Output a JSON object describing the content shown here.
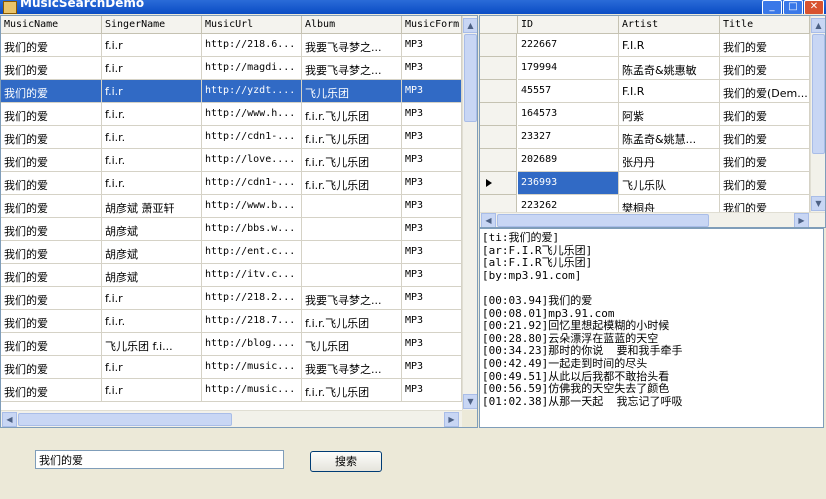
{
  "window": {
    "title": "MusicSearchDemo",
    "minimize": "_",
    "maximize": "□",
    "close": "✕"
  },
  "left_grid": {
    "columns": [
      "MusicName",
      "SingerName",
      "MusicUrl",
      "Album",
      "MusicForm"
    ],
    "selected_index": 2,
    "rows": [
      [
        "我们的爱",
        "f.i.r",
        "http://218.6...",
        "我要飞寻梦之...",
        "MP3"
      ],
      [
        "我们的爱",
        "f.i.r",
        "http://magdi...",
        "我要飞寻梦之...",
        "MP3"
      ],
      [
        "我们的爱",
        "f.i.r",
        "http://yzdt....",
        "飞儿乐团",
        "MP3"
      ],
      [
        "我们的爱",
        "f.i.r.",
        "http://www.h...",
        "f.i.r.飞儿乐团",
        "MP3"
      ],
      [
        "我们的爱",
        "f.i.r.",
        "http://cdn1-...",
        "f.i.r.飞儿乐团",
        "MP3"
      ],
      [
        "我们的爱",
        "f.i.r.",
        "http://love....",
        "f.i.r.飞儿乐团",
        "MP3"
      ],
      [
        "我们的爱",
        "f.i.r.",
        "http://cdn1-...",
        "f.i.r.飞儿乐团",
        "MP3"
      ],
      [
        "我们的爱",
        "胡彦斌 萧亚轩",
        "http://www.b...",
        "",
        "MP3"
      ],
      [
        "我们的爱",
        "胡彦斌",
        "http://bbs.w...",
        "",
        "MP3"
      ],
      [
        "我们的爱",
        "胡彦斌",
        "http://ent.c...",
        "",
        "MP3"
      ],
      [
        "我们的爱",
        "胡彦斌",
        "http://itv.c...",
        "",
        "MP3"
      ],
      [
        "我们的爱",
        "f.i.r",
        "http://218.2...",
        "我要飞寻梦之...",
        "MP3"
      ],
      [
        "我们的爱",
        "f.i.r.",
        "http://218.7...",
        "f.i.r.飞儿乐团",
        "MP3"
      ],
      [
        "我们的爱",
        "飞儿乐团 f.i...",
        "http://blog....",
        "飞儿乐团",
        "MP3"
      ],
      [
        "我们的爱",
        "f.i.r",
        "http://music...",
        "我要飞寻梦之...",
        "MP3"
      ],
      [
        "我们的爱",
        "f.i.r",
        "http://music...",
        "f.i.r.飞儿乐团",
        "MP3"
      ]
    ]
  },
  "right_grid": {
    "columns": [
      "ID",
      "Artist",
      "Title"
    ],
    "current_index": 6,
    "rows": [
      [
        "222667",
        "F.I.R",
        "我们的爱"
      ],
      [
        "179994",
        "陈孟奇&姚惠敏",
        "我们的爱"
      ],
      [
        "45557",
        "F.I.R",
        "我们的爱(Dem..."
      ],
      [
        "164573",
        "阿紫",
        "我们的爱"
      ],
      [
        "23327",
        "陈孟奇&姚慧...",
        "我们的爱"
      ],
      [
        "202689",
        "张丹丹",
        "我们的爱"
      ],
      [
        "236993",
        "飞儿乐队",
        "我们的爱"
      ],
      [
        "223262",
        "樊桐舟",
        "我们的爱"
      ]
    ]
  },
  "lyrics": {
    "text": "[ti:我们的爱]\n[ar:F.I.R飞儿乐团]\n[al:F.I.R飞儿乐团]\n[by:mp3.91.com]\n\n[00:03.94]我们的爱\n[00:08.01]mp3.91.com\n[00:21.92]回忆里想起模糊的小时候\n[00:28.80]云朵漂浮在蓝蓝的天空\n[00:34.23]那时的你说  要和我手牵手\n[00:42.49]一起走到时间的尽头\n[00:49.51]从此以后我都不敢抬头看\n[00:56.59]仿佛我的天空失去了颜色\n[01:02.38]从那一天起  我忘记了呼吸"
  },
  "search": {
    "value": "我们的爱",
    "button_label": "搜索"
  },
  "colors": {
    "selection": "#316ac5",
    "grid_border": "#7f9db9",
    "form_bg": "#ece9d8"
  }
}
